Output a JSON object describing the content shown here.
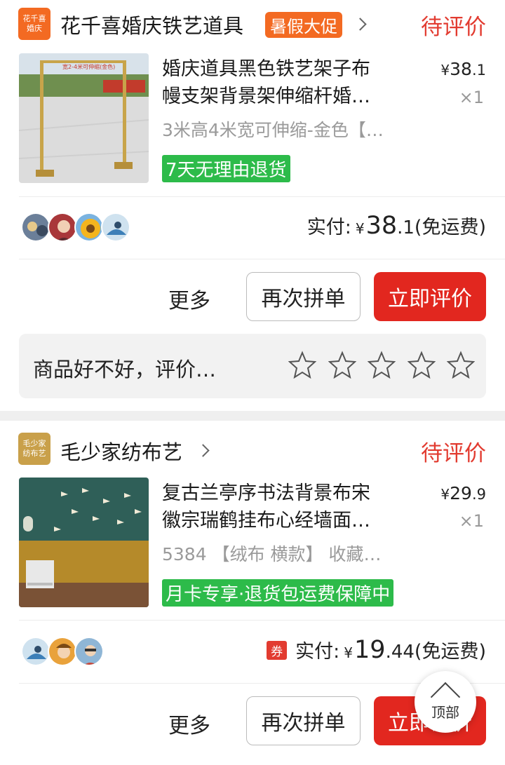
{
  "orders": [
    {
      "shop": {
        "logo_text": "花千喜婚庆",
        "logo_color": "#f36a22",
        "name": "花千喜婚庆铁艺道具",
        "promo_tag": "暑假大促"
      },
      "status": "待评价",
      "product": {
        "title_line1": "婚庆道具黑色铁艺架子布",
        "title_line2": "幔支架背景架伸缩杆婚…",
        "spec": "3米高4米宽可伸缩-金色【…",
        "service_tag": "7天无理由退货",
        "price_currency": "¥",
        "price_int": "38",
        "price_dec": ".1",
        "quantity": "×1",
        "thumb_caption": "宽2-4米可伸缩(金色)"
      },
      "payment": {
        "label": "实付:",
        "currency": "¥",
        "amount_int": "38",
        "amount_dec": ".1",
        "shipping": "(免运费)"
      },
      "actions": {
        "more": "更多",
        "reorder": "再次拼单",
        "review": "立即评价"
      },
      "review_prompt": {
        "text": "商品好不好，评价…",
        "stars": 5
      }
    },
    {
      "shop": {
        "logo_text": "毛少家纺布艺",
        "logo_color": "#c9a04a",
        "name": "毛少家纺布艺"
      },
      "status": "待评价",
      "product": {
        "title_line1": "复古兰亭序书法背景布宋",
        "title_line2": "徽宗瑞鹤挂布心经墙面…",
        "spec": "5384 【绒布 横款】 收藏…",
        "service_tag": "月卡专享·退货包运费保障中",
        "price_currency": "¥",
        "price_int": "29",
        "price_dec": ".9",
        "quantity": "×1"
      },
      "payment": {
        "coupon": "券",
        "label": "实付:",
        "currency": "¥",
        "amount_int": "19",
        "amount_dec": ".44",
        "shipping": "(免运费)"
      },
      "actions": {
        "more": "更多",
        "reorder": "再次拼单",
        "review": "立即评价"
      }
    }
  ],
  "back_to_top": "顶部",
  "colors": {
    "accent_red": "#e2271f",
    "status_red": "#e23b30",
    "service_green": "#2dbb4a",
    "promo_orange": "#f36a22"
  }
}
